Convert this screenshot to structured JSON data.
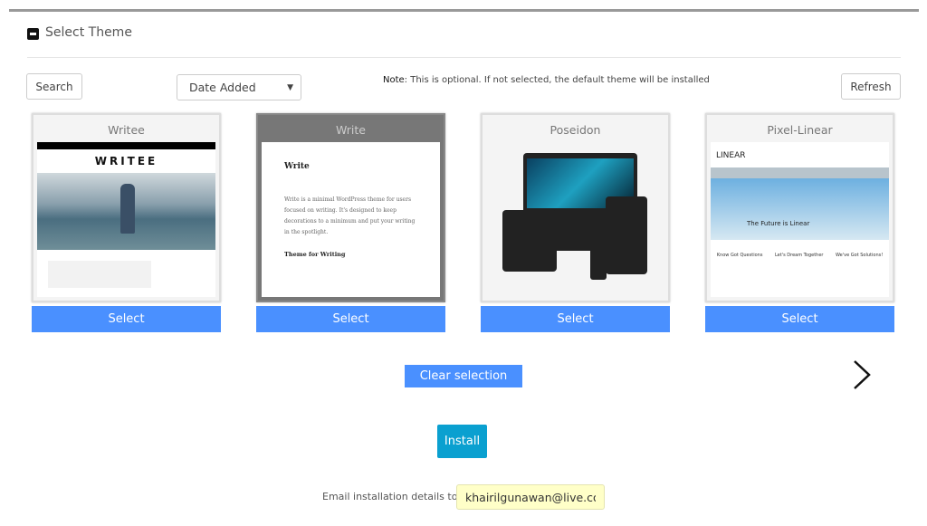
{
  "section": {
    "title": "Select Theme",
    "collapse_icon": "minus-square-icon"
  },
  "toolbar": {
    "search_label": "Search",
    "sort_value": "Date Added",
    "note_prefix": "Note",
    "note_text": ": This is optional. If not selected, the default theme will be installed",
    "refresh_label": "Refresh"
  },
  "themes": [
    {
      "name": "Writee",
      "select_label": "Select",
      "selected": false,
      "preview_logo": "WRITEE"
    },
    {
      "name": "Write",
      "select_label": "Select",
      "selected": true,
      "preview_logo": "Write",
      "preview_text": "Write is a minimal WordPress theme for users focused on writing. It's designed to keep decorations to a minimum and put your writing in the spotlight.",
      "preview_post": "Theme for Writing"
    },
    {
      "name": "Poseidon",
      "select_label": "Select",
      "selected": false
    },
    {
      "name": "Pixel-Linear",
      "select_label": "Select",
      "selected": false,
      "preview_logo": "LINEAR",
      "preview_hero": "The Future is Linear",
      "preview_cols": [
        "Know Got Questions",
        "Let's Dream Together",
        "We've Got Solutions!"
      ]
    }
  ],
  "actions": {
    "clear_label": "Clear selection",
    "next_icon": "chevron-right-icon",
    "install_label": "Install"
  },
  "email": {
    "label": "Email installation details to :",
    "value": "khairilgunawan@live.com"
  },
  "colors": {
    "select_button": "#4a90ff",
    "install_button": "#0aa0d0",
    "email_bg": "#ffffc8"
  }
}
